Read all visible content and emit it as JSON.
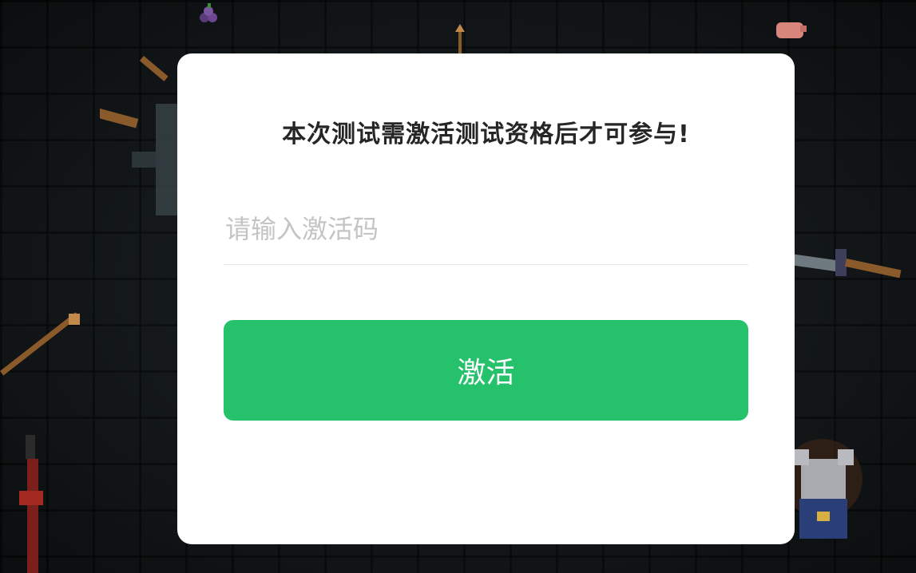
{
  "background": {
    "description_icon": "pixel-dungeon-wall",
    "color": "#151a1c"
  },
  "dialog": {
    "title": "本次测试需激活测试资格后才可参与!",
    "input": {
      "value": "",
      "placeholder": "请输入激活码"
    },
    "activate_label": "激活"
  },
  "colors": {
    "accent": "#25c26b",
    "title": "#262626",
    "placeholder": "#c4c4c4"
  }
}
